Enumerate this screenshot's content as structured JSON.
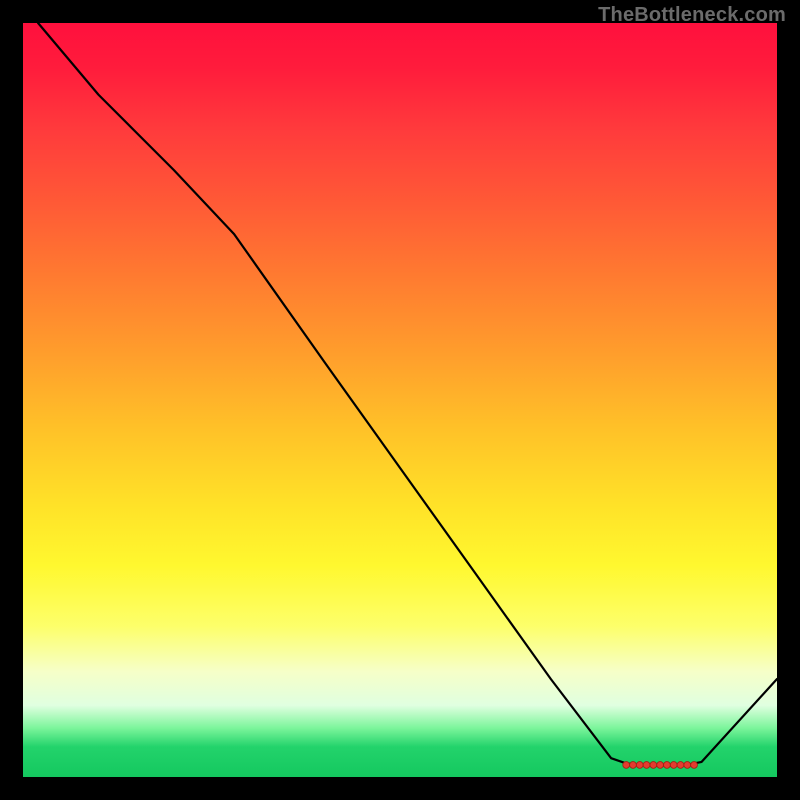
{
  "watermark": "TheBottleneck.com",
  "colors": {
    "background": "#000000",
    "curve": "#000000",
    "marker_fill": "#e43b2f",
    "marker_stroke": "#a31f12"
  },
  "chart_data": {
    "type": "line",
    "title": "",
    "xlabel": "",
    "ylabel": "",
    "xlim": [
      0,
      100
    ],
    "ylim": [
      0,
      100
    ],
    "x": [
      2,
      10,
      20,
      28,
      40,
      50,
      60,
      70,
      78,
      80,
      82,
      84,
      86,
      88,
      90,
      100
    ],
    "values": [
      100,
      90.5,
      80.5,
      72,
      55,
      41,
      27,
      13,
      2.5,
      1.8,
      1.6,
      1.5,
      1.5,
      1.6,
      2.0,
      13
    ],
    "optimal_band": {
      "x_start": 80,
      "x_end": 89,
      "y": 1.6
    },
    "markers_x": [
      80.0,
      80.9,
      81.8,
      82.7,
      83.6,
      84.5,
      85.4,
      86.3,
      87.2,
      88.1,
      89.0
    ]
  }
}
